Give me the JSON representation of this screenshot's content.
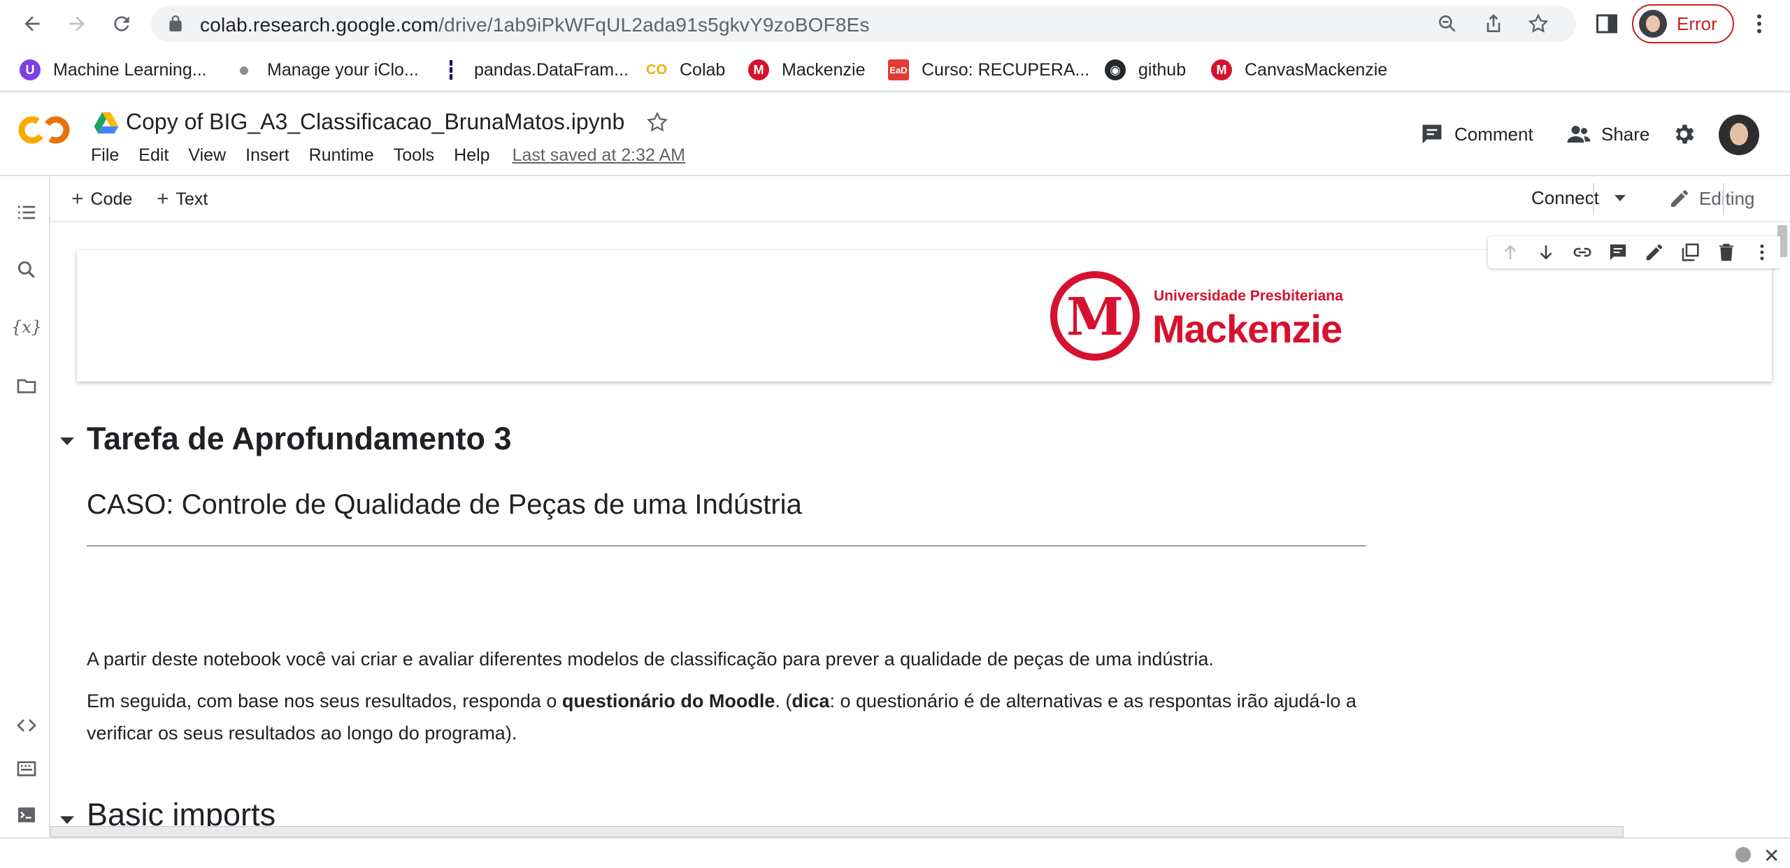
{
  "browser": {
    "url_host": "colab.research.google.com",
    "url_path": "/drive/1ab9iPkWFqUL2ada91s5gkvY9zoBOF8Es",
    "profile_status": "Error"
  },
  "bookmarks": [
    {
      "label": "Machine Learning...",
      "color": "#7b3fe4"
    },
    {
      "label": "Manage your iClo...",
      "color": "#8e8e93"
    },
    {
      "label": "pandas.DataFram...",
      "color": "#150458"
    },
    {
      "label": "Colab",
      "color": "#f9ab00"
    },
    {
      "label": "Mackenzie",
      "color": "#d6112e"
    },
    {
      "label": "Curso: RECUPERA...",
      "color": "#e53935"
    },
    {
      "label": "github",
      "color": "#24292e"
    },
    {
      "label": "CanvasMackenzie",
      "color": "#d6112e"
    }
  ],
  "colab": {
    "notebook_title": "Copy of BIG_A3_Classificacao_BrunaMatos.ipynb",
    "menu": [
      "File",
      "Edit",
      "View",
      "Insert",
      "Runtime",
      "Tools",
      "Help"
    ],
    "last_saved": "Last saved at 2:32 AM",
    "comment_label": "Comment",
    "share_label": "Share"
  },
  "toolbar": {
    "code_label": "Code",
    "text_label": "Text",
    "connect_label": "Connect",
    "editing_label": "Editing"
  },
  "logo": {
    "university_label": "Universidade Presbiteriana",
    "name": "Mackenzie",
    "monogram": "M",
    "brand_color": "#d6112e"
  },
  "notebook": {
    "heading": "Tarefa de Aprofundamento 3",
    "subheading": "CASO: Controle de Qualidade de Peças de uma Indústria",
    "paragraph1": "A partir deste notebook você vai criar e avaliar diferentes modelos de classificação para prever a qualidade de peças de uma indústria.",
    "p2_a": "Em seguida, com base nos seus resultados, responda o ",
    "p2_b": "questionário do Moodle",
    "p2_c": ". (",
    "p2_d": "dica",
    "p2_e": ": o questionário é de alternativas e as respontas irão ajudá-lo a verificar os seus resultados ao longo do programa).",
    "next_section": "Basic imports"
  },
  "status": {
    "close_glyph": "✕"
  }
}
